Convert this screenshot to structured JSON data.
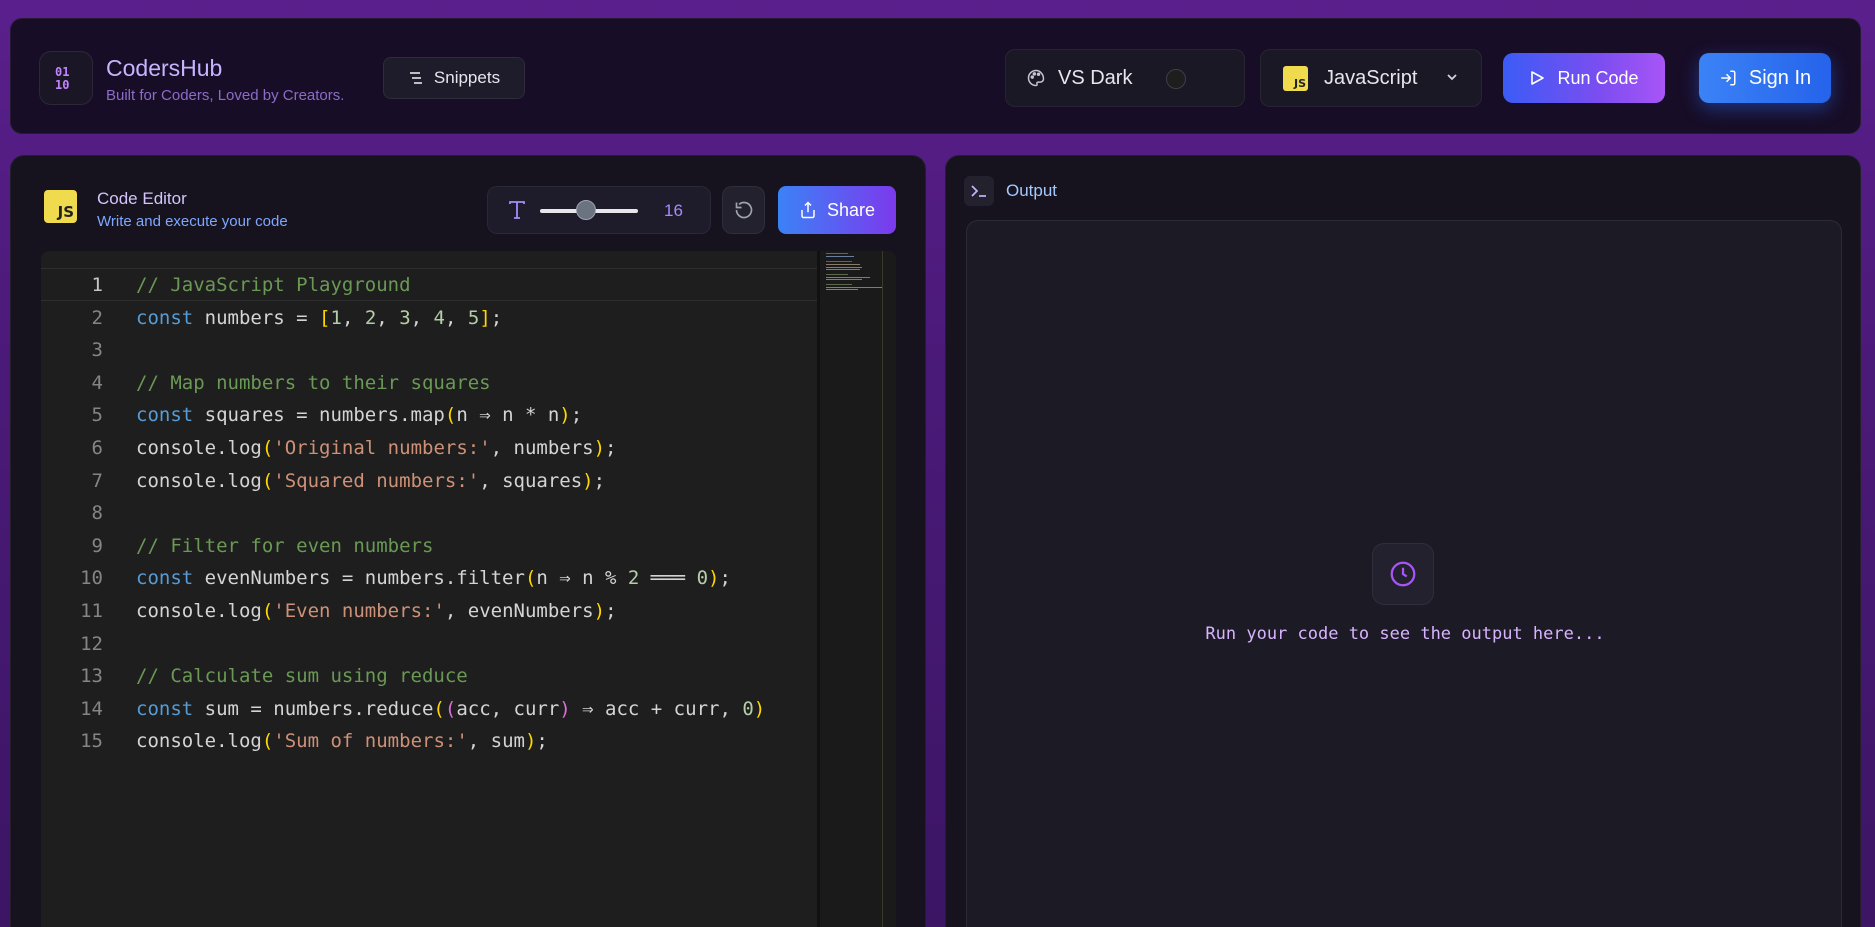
{
  "header": {
    "brand_title": "CodersHub",
    "brand_subtitle": "Built for Coders, Loved by Creators.",
    "snippets_label": "Snippets",
    "theme_label": "VS Dark",
    "language_label": "JavaScript",
    "language_badge": "JS",
    "run_label": "Run Code",
    "signin_label": "Sign In"
  },
  "editor": {
    "badge": "JS",
    "title": "Code Editor",
    "subtitle": "Write and execute your code",
    "font_size": "16",
    "font_size_fraction": 0.45,
    "share_label": "Share",
    "active_line": 1,
    "line_numbers": [
      "1",
      "2",
      "3",
      "4",
      "5",
      "6",
      "7",
      "8",
      "9",
      "10",
      "11",
      "12",
      "13",
      "14",
      "15"
    ],
    "lines": [
      "// JavaScript Playground",
      "const numbers = [1, 2, 3, 4, 5];",
      "",
      "// Map numbers to their squares",
      "const squares = numbers.map(n ⇒ n * n);",
      "console.log('Original numbers:', numbers);",
      "console.log('Squared numbers:', squares);",
      "",
      "// Filter for even numbers",
      "const evenNumbers = numbers.filter(n ⇒ n % 2 ═══ 0);",
      "console.log('Even numbers:', evenNumbers);",
      "",
      "// Calculate sum using reduce",
      "const sum = numbers.reduce((acc, curr) ⇒ acc + curr, 0)",
      "console.log('Sum of numbers:', sum);"
    ]
  },
  "output": {
    "title": "Output",
    "placeholder": "Run your code to see the output here..."
  },
  "icons": {
    "logo": "binary-code-icon",
    "snippets": "list-icon",
    "theme": "palette-icon",
    "language_chevron": "chevron-down-icon",
    "run": "play-icon",
    "signin": "login-icon",
    "font": "type-icon",
    "reset": "rotate-ccw-icon",
    "share": "share-icon",
    "output": "terminal-icon",
    "waiting": "clock-icon"
  },
  "colors": {
    "accent_purple": "#a855f7",
    "accent_blue": "#3b82f6",
    "js_yellow": "#f0db4f"
  }
}
